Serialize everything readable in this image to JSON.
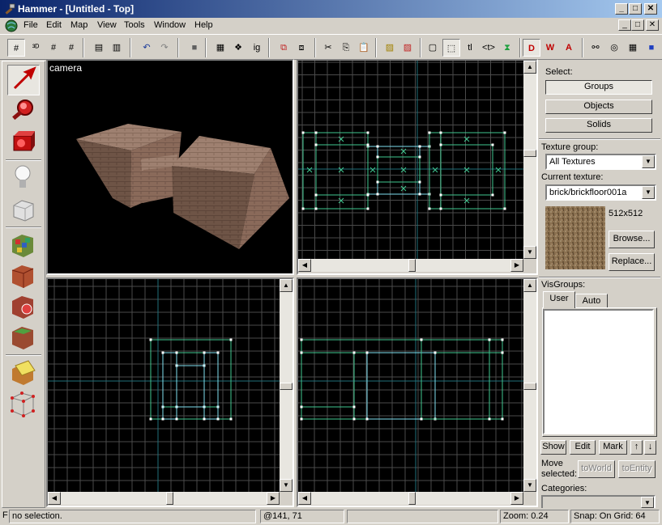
{
  "window": {
    "title": "Hammer - [Untitled - Top]",
    "controls": [
      "_",
      "□",
      "✕"
    ]
  },
  "menu": {
    "items": [
      "File",
      "Edit",
      "Map",
      "View",
      "Tools",
      "Window",
      "Help"
    ]
  },
  "toolbar": {
    "grid_label": "ig",
    "texture_lock_label": "tl",
    "carve_label": "<t>"
  },
  "viewports": {
    "camera": {
      "label": "camera"
    }
  },
  "select_panel": {
    "label": "Select:",
    "buttons": [
      "Groups",
      "Objects",
      "Solids"
    ],
    "selected": "Groups"
  },
  "texture": {
    "group_label": "Texture group:",
    "group_value": "All Textures",
    "current_label": "Current texture:",
    "current_value": "brick/brickfloor001a",
    "size": "512x512",
    "browse_label": "Browse...",
    "replace_label": "Replace..."
  },
  "visgroups": {
    "label": "VisGroups:",
    "tabs": [
      "User",
      "Auto"
    ],
    "active_tab": "User",
    "show_label": "Show",
    "edit_label": "Edit",
    "mark_label": "Mark",
    "up_label": "↑",
    "down_label": "↓"
  },
  "move_selected": {
    "label_line1": "Move",
    "label_line2": "selected:",
    "to_world": "toWorld",
    "to_entity": "toEntity"
  },
  "categories": {
    "label": "Categories:"
  },
  "status": {
    "help_key": "F",
    "selection": "no selection.",
    "coords": "@141, 71",
    "zoom": "Zoom: 0.24",
    "snap": "Snap: On Grid: 64"
  },
  "colors": {
    "titlebar_start": "#0a246a",
    "titlebar_end": "#a6caf0",
    "face": "#d4d0c8",
    "viewport_bg": "#000000",
    "grid_minor": "#4a4a4a",
    "grid_major": "#20707a",
    "brush_green": "#40c890",
    "brush_cyan": "#80e0f0",
    "brick": "#8a6a5a"
  }
}
